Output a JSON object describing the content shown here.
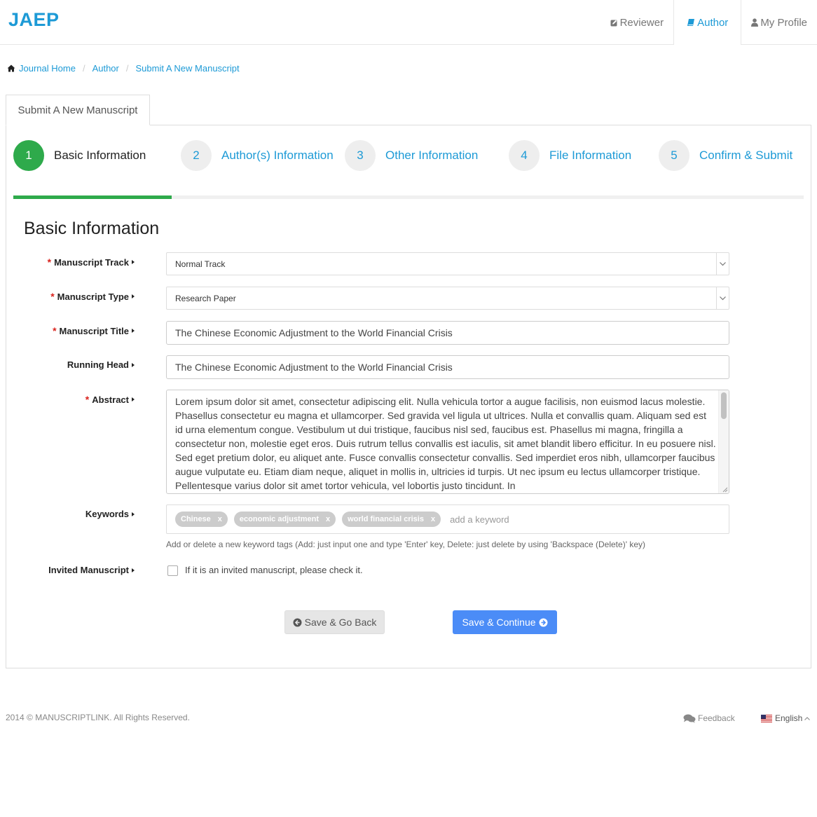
{
  "header": {
    "brand": "JAEP",
    "nav": [
      {
        "label": "Reviewer",
        "icon": "edit-icon"
      },
      {
        "label": "Author",
        "icon": "book-icon",
        "active": true
      },
      {
        "label": "My Profile",
        "icon": "user-icon"
      }
    ]
  },
  "breadcrumb": [
    "Journal Home",
    "Author",
    "Submit A New Manuscript"
  ],
  "tab": "Submit A New Manuscript",
  "steps": [
    {
      "num": "1",
      "label": "Basic Information",
      "active": true
    },
    {
      "num": "2",
      "label": "Author(s) Information"
    },
    {
      "num": "3",
      "label": "Other Information"
    },
    {
      "num": "4",
      "label": "File Information"
    },
    {
      "num": "5",
      "label": "Confirm & Submit"
    }
  ],
  "progress": 0.2,
  "section_title": "Basic Information",
  "form": {
    "track_label": "Manuscript Track",
    "track_value": "Normal Track",
    "type_label": "Manuscript Type",
    "type_value": "Research Paper",
    "title_label": "Manuscript Title",
    "title_value": "The Chinese Economic Adjustment to the World Financial Crisis",
    "running_head_label": "Running Head",
    "running_head_value": "The Chinese Economic Adjustment to the World Financial Crisis",
    "abstract_label": "Abstract",
    "abstract_value": "Lorem ipsum dolor sit amet, consectetur adipiscing elit. Nulla vehicula tortor a augue facilisis, non euismod lacus molestie. Phasellus consectetur eu magna et ullamcorper. Sed gravida vel ligula ut ultrices. Nulla et convallis quam. Aliquam sed est id urna elementum congue. Vestibulum ut dui tristique, faucibus nisl sed, faucibus est. Phasellus mi magna, fringilla a consectetur non, molestie eget eros. Duis rutrum tellus convallis est iaculis, sit amet blandit libero efficitur. In eu posuere nisl. Sed eget pretium dolor, eu aliquet ante. Fusce convallis consectetur convallis. Sed imperdiet eros nibh, ullamcorper faucibus augue vulputate eu. Etiam diam neque, aliquet in mollis in, ultricies id turpis. Ut nec ipsum eu lectus ullamcorper tristique. Pellentesque varius dolor sit amet tortor vehicula, vel lobortis justo tincidunt. In",
    "keywords_label": "Keywords",
    "keywords": [
      "Chinese",
      "economic adjustment",
      "world financial crisis"
    ],
    "keyword_remove": "x",
    "keyword_placeholder": "add a keyword",
    "keywords_help": "Add or delete a new keyword tags (Add: just input one and type 'Enter' key, Delete: just delete by using 'Backspace (Delete)' key)",
    "invited_label": "Invited Manuscript",
    "invited_text": "If it is an invited manuscript, please check it."
  },
  "buttons": {
    "back": "Save & Go Back",
    "next": "Save & Continue"
  },
  "footer": {
    "copyright": "2014 © MANUSCRIPTLINK. All Rights Reserved.",
    "feedback": "Feedback",
    "language": "English"
  },
  "colors": {
    "brand": "#1d9ad6",
    "step_active": "#2eaa4b",
    "required": "#d9231d",
    "primary_button": "#4b8cf7"
  }
}
